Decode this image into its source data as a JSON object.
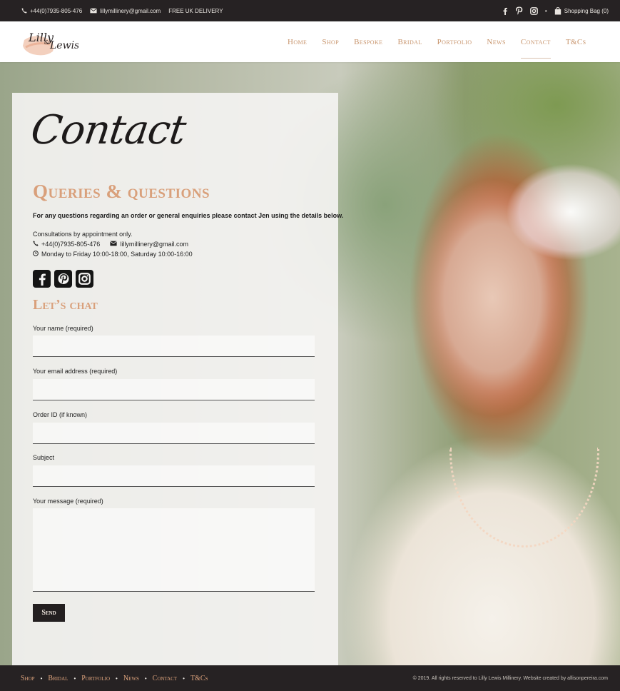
{
  "topbar": {
    "phone": "+44(0)7935-805-476",
    "email": "lillymillinery@gmail.com",
    "delivery": "FREE UK DELIVERY",
    "social_icons": [
      "facebook-icon",
      "pinterest-icon",
      "instagram-icon"
    ],
    "separator": "•",
    "cart_label": "Shopping Bag (0)"
  },
  "header": {
    "logo_text": "Lilly Lewis",
    "nav": [
      "Home",
      "Shop",
      "Bespoke",
      "Bridal",
      "Portfolio",
      "News",
      "Contact",
      "T&Cs"
    ],
    "active_nav": "Contact"
  },
  "main": {
    "title": "Contact",
    "queries_heading": "Queries & questions",
    "intro": "For any questions regarding an order or general enquiries please contact Jen using the details below.",
    "consult": "Consultations by appointment only.",
    "phone": "+44(0)7935-805-476",
    "email": "lillymillinery@gmail.com",
    "hours": "Monday to Friday 10:00-18:00, Saturday 10:00-16:00",
    "chat_heading": "Let’s chat",
    "form": {
      "name_label": "Your name (required)",
      "email_label": "Your email address (required)",
      "order_label": "Order ID (if known)",
      "subject_label": "Subject",
      "message_label": "Your message (required)",
      "send_label": "Send"
    }
  },
  "footer": {
    "nav": [
      "Shop",
      "Bridal",
      "Portfolio",
      "News",
      "Contact",
      "T&Cs"
    ],
    "separator": "•",
    "copyright": "© 2019. All rights reserved to Lilly Lewis Millinery. Website created by allisonpereira.com"
  },
  "colors": {
    "accent": "#d9a07b",
    "dark": "#262223"
  }
}
